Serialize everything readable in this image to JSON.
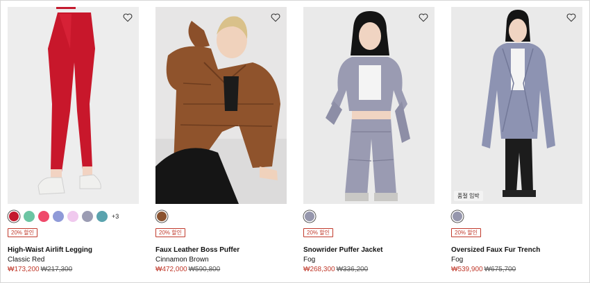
{
  "products": [
    {
      "name": "High-Waist Airlift Legging",
      "color": "Classic Red",
      "price": "₩173,200",
      "original_price": "₩217,300",
      "sale_badge": "20% 할인",
      "swatches": [
        "#c41a2e",
        "#6cc5a3",
        "#ef4a6b",
        "#8f9ad8",
        "#f0c9ee",
        "#9b9cb3",
        "#5aa3ae"
      ],
      "more_colors": "+3",
      "image_bg": "#ededed",
      "stock_badge": ""
    },
    {
      "name": "Faux Leather Boss Puffer",
      "color": "Cinnamon Brown",
      "price": "₩472,000",
      "original_price": "₩590,800",
      "sale_badge": "20% 할인",
      "swatches": [
        "#8a5330"
      ],
      "more_colors": "",
      "image_bg": "#e7e6e6",
      "stock_badge": ""
    },
    {
      "name": "Snowrider Puffer Jacket",
      "color": "Fog",
      "price": "₩268,300",
      "original_price": "₩336,200",
      "sale_badge": "20% 할인",
      "swatches": [
        "#9697ad"
      ],
      "more_colors": "",
      "image_bg": "#eaeaea",
      "stock_badge": ""
    },
    {
      "name": "Oversized Faux Fur Trench",
      "color": "Fog",
      "price": "₩539,900",
      "original_price": "₩675,700",
      "sale_badge": "20% 할인",
      "swatches": [
        "#9697ad"
      ],
      "more_colors": "",
      "image_bg": "#eaeaea",
      "stock_badge": "품절 임박"
    }
  ],
  "icons": {
    "wishlist": "heart-outline-icon"
  },
  "colors": {
    "sale": "#c0392b"
  }
}
